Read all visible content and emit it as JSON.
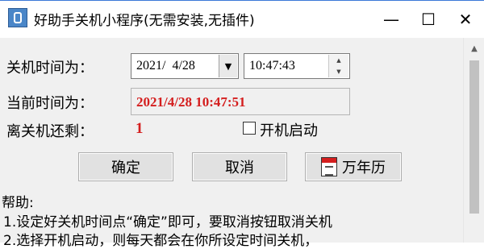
{
  "window": {
    "title": "好助手关机小程序(无需安装,无插件)",
    "controls": {
      "minimize": "—",
      "maximize": "☐",
      "close": "✕"
    }
  },
  "form": {
    "shutdown_time_label": "关机时间为：",
    "date_value": "2021/  4/28",
    "time_value": "10:47:43",
    "current_time_label": "当前时间为：",
    "current_time_value": "2021/4/28 10:47:51",
    "remaining_label": "离关机还剩：",
    "remaining_value": "1",
    "startup_checkbox_label": "开机启动",
    "startup_checked": false
  },
  "buttons": {
    "ok": "确定",
    "cancel": "取消",
    "calendar": "万年历"
  },
  "help": {
    "title": "帮助:",
    "lines": [
      "1.设定好关机时间点“确定”即可，要取消按钮取消关机",
      "2.选择开机启动，则每天都会在你所设定时间关机，"
    ]
  },
  "colors": {
    "accent_red": "#d41e1e",
    "title_icon": "#4a86c8"
  },
  "icons": {
    "app": "app-icon",
    "calendar": "calendar-icon"
  }
}
